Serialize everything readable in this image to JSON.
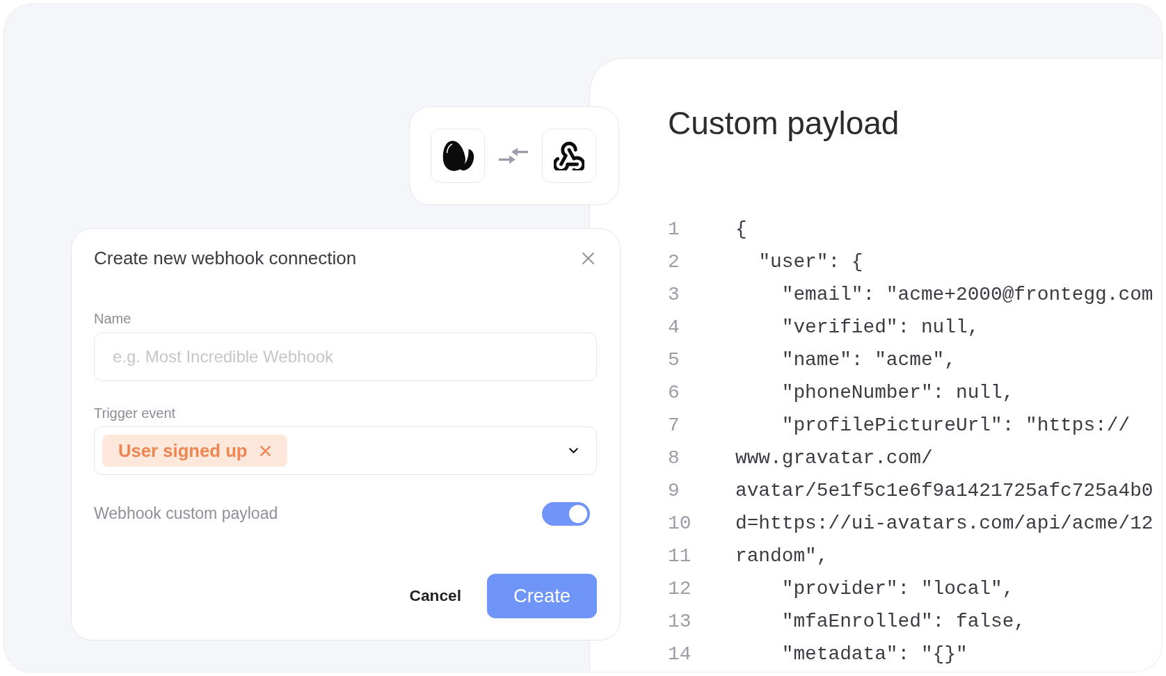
{
  "dialog": {
    "title": "Create new webhook connection",
    "fields": [
      {
        "kind": "text",
        "label": "Name",
        "placeholder": "e.g. Most Incredible Webhook"
      },
      {
        "kind": "tags",
        "label": "Trigger event",
        "tags": [
          "User signed up"
        ]
      }
    ],
    "toggle": {
      "label": "Webhook custom payload",
      "on": true
    },
    "buttons": [
      {
        "label": "Cancel",
        "kind": "secondary"
      },
      {
        "label": "Create",
        "kind": "primary"
      }
    ]
  },
  "payload_panel": {
    "title": "Custom payload",
    "lines": [
      {
        "number": "1",
        "text": "{"
      },
      {
        "number": "2",
        "text": "  \"user\": {"
      },
      {
        "number": "3",
        "text": "    \"email\": \"acme+2000@frontegg.com"
      },
      {
        "number": "4",
        "text": "    \"verified\": null,"
      },
      {
        "number": "5",
        "text": "    \"name\": \"acme\","
      },
      {
        "number": "6",
        "text": "    \"phoneNumber\": null,"
      },
      {
        "number": "7",
        "text": "    \"profilePictureUrl\": \"https://"
      },
      {
        "number": "8",
        "text": "www.gravatar.com/"
      },
      {
        "number": "9",
        "text": "avatar/5e1f5c1e6f9a1421725afc725a4b0"
      },
      {
        "number": "10",
        "text": "d=https://ui-avatars.com/api/acme/12"
      },
      {
        "number": "11",
        "text": "random\","
      },
      {
        "number": "12",
        "text": "    \"provider\": \"local\","
      },
      {
        "number": "13",
        "text": "    \"mfaEnrolled\": false,"
      },
      {
        "number": "14",
        "text": "    \"metadata\": \"{}\""
      }
    ]
  }
}
